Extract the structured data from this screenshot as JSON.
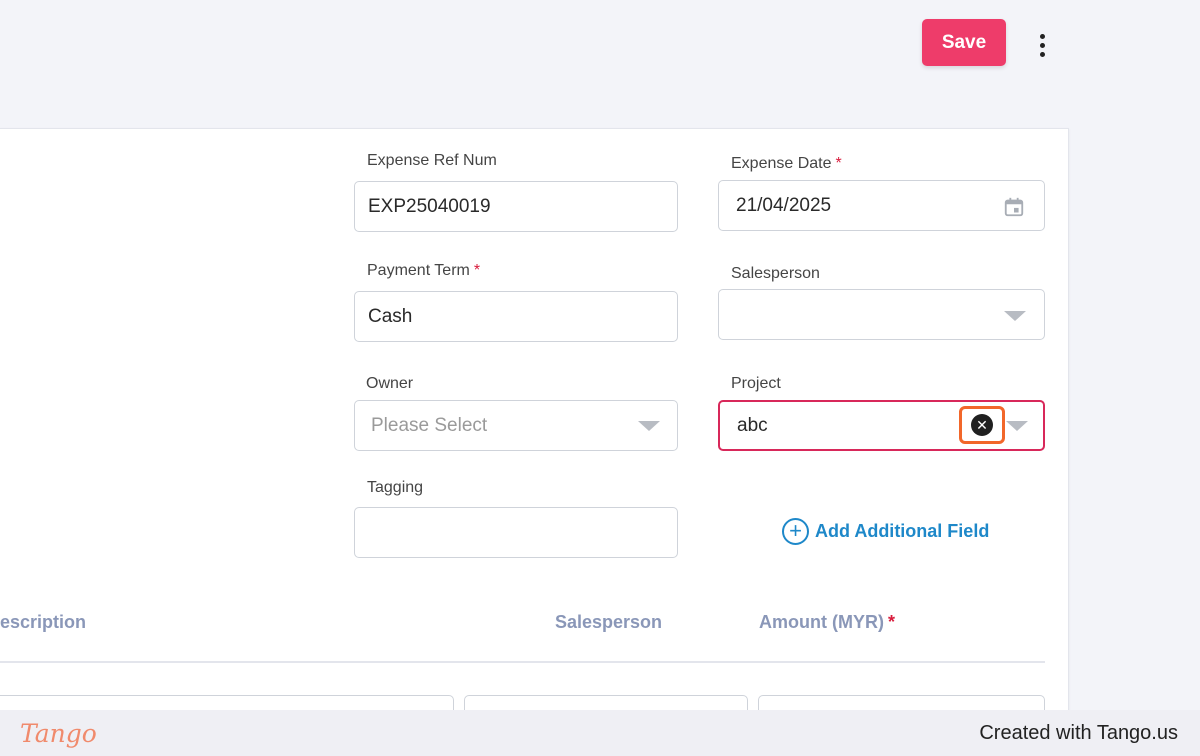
{
  "toolbar": {
    "save_label": "Save",
    "more_icon": "vertical-dots-icon"
  },
  "form": {
    "expense_ref_num": {
      "label": "Expense Ref Num",
      "value": "EXP25040019"
    },
    "expense_date": {
      "label": "Expense Date",
      "required": "*",
      "value": "21/04/2025",
      "icon": "calendar-icon"
    },
    "payment_term": {
      "label": "Payment Term",
      "required": "*",
      "value": "Cash"
    },
    "salesperson": {
      "label": "Salesperson",
      "value": ""
    },
    "owner": {
      "label": "Owner",
      "placeholder": "Please Select"
    },
    "project": {
      "label": "Project",
      "value": "abc",
      "clear_icon": "clear-x-icon"
    },
    "tagging": {
      "label": "Tagging",
      "value": ""
    },
    "add_field_label": "Add Additional Field"
  },
  "table": {
    "headers": [
      "escription",
      "Salesperson",
      "Amount (MYR)"
    ],
    "required_mark": "*"
  },
  "footer": {
    "logo": "Tango",
    "credit": "Created with Tango.us"
  },
  "colors": {
    "accent": "#ee3c6a",
    "link": "#1e88c9",
    "highlight": "#f2672a"
  }
}
